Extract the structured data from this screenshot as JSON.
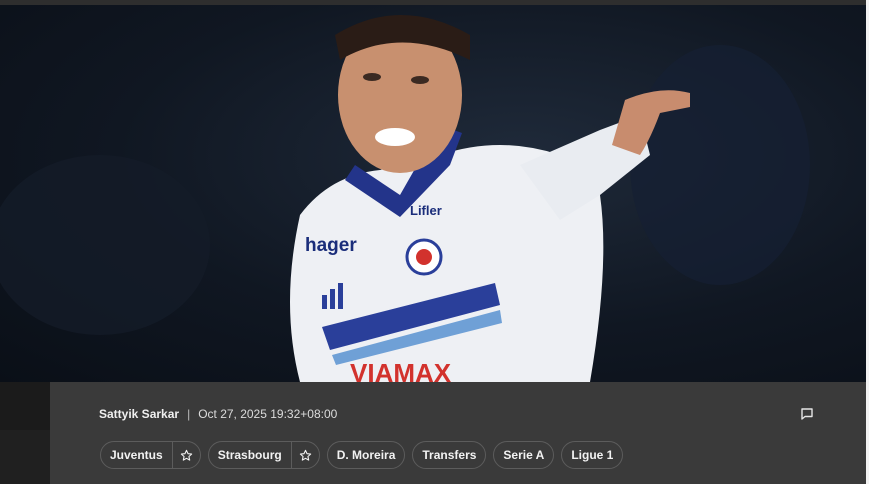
{
  "hero": {
    "image_name": "player-pointing-photo",
    "shirt_sponsor_text": "hager",
    "shirt_front_text": "VIAMAX",
    "shirt_collar_text": "Lifler"
  },
  "article_meta": {
    "author": "Sattyik Sarkar",
    "separator": "|",
    "date": "Oct 27, 2025 19:32+08:00",
    "comment_icon": "comment-icon"
  },
  "tags": [
    {
      "label": "Juventus",
      "followable": true
    },
    {
      "label": "Strasbourg",
      "followable": true
    },
    {
      "label": "D. Moreira",
      "followable": false
    },
    {
      "label": "Transfers",
      "followable": false
    },
    {
      "label": "Serie A",
      "followable": false
    },
    {
      "label": "Ligue 1",
      "followable": false
    }
  ],
  "colors": {
    "panel": "#3a3a3a",
    "text": "#f2f2f2",
    "pill_border": "#5c5c5c",
    "shirt_blue": "#2a3f9a",
    "sponsor_red": "#d2322d"
  }
}
